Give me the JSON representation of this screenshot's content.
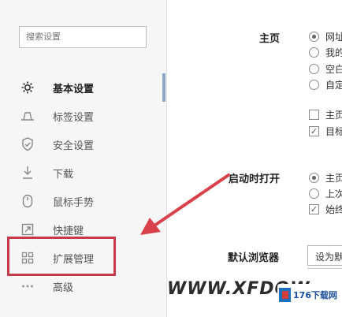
{
  "search": {
    "placeholder": "搜索设置"
  },
  "sidebar": {
    "items": [
      {
        "label": "基本设置",
        "icon": "gear-icon",
        "active": true
      },
      {
        "label": "标签设置",
        "icon": "tab-icon"
      },
      {
        "label": "安全设置",
        "icon": "shield-check-icon"
      },
      {
        "label": "下载",
        "icon": "download-icon"
      },
      {
        "label": "鼠标手势",
        "icon": "mouse-icon"
      },
      {
        "label": "快捷键",
        "icon": "shortcut-icon"
      },
      {
        "label": "扩展管理",
        "icon": "extensions-icon"
      },
      {
        "label": "高级",
        "icon": "more-icon"
      }
    ]
  },
  "settings": {
    "homepage": {
      "label": "主页",
      "options": [
        "网址",
        "我的",
        "空白",
        "自定"
      ],
      "checkboxes": [
        "主页",
        "目标"
      ]
    },
    "startup": {
      "label": "启动时打开",
      "options": [
        "主页",
        "上次"
      ],
      "checkbox": "始终"
    },
    "default_browser": {
      "label": "默认浏览器",
      "button": "设为默"
    }
  },
  "watermark": {
    "text": "WWW.XFDOW",
    "logo_text": "176下载网"
  },
  "colors": {
    "highlight": "#c53a46",
    "arrow": "#d8404a",
    "accent": "#8fa6c8"
  }
}
